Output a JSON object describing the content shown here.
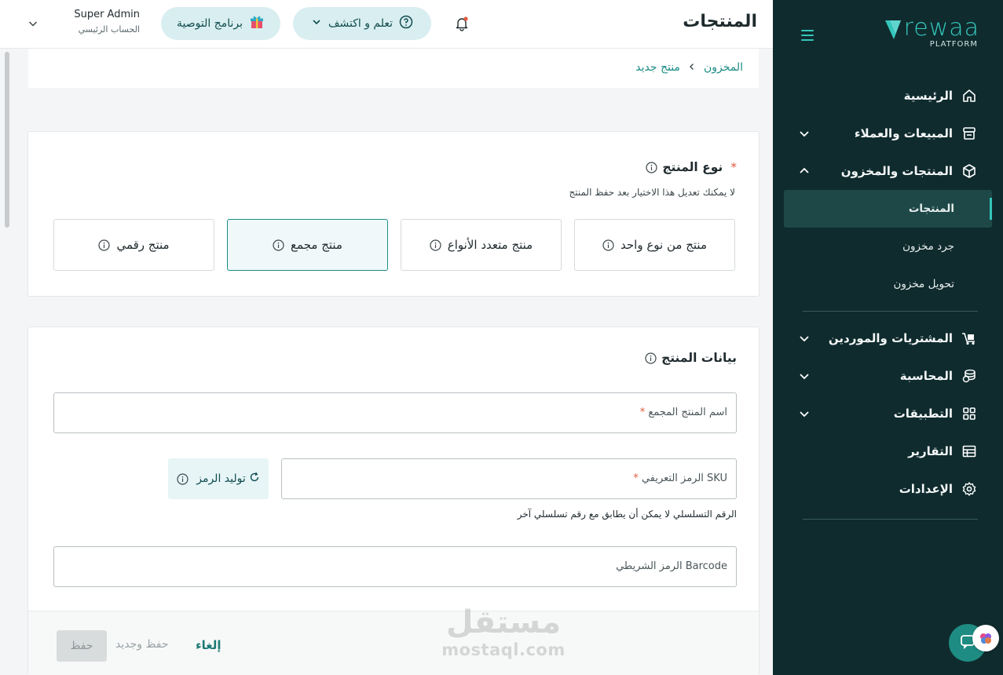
{
  "sidebar": {
    "logo_text": "rewaa",
    "logo_sub": "PLATFORM",
    "items": [
      {
        "label": "الرئيسية",
        "icon": "home-icon"
      },
      {
        "label": "المبيعات والعملاء",
        "icon": "store-icon"
      },
      {
        "label": "المنتجات والمخزون",
        "icon": "box-icon"
      },
      {
        "label": "المشتريات والموردين",
        "icon": "truck-icon"
      },
      {
        "label": "المحاسبة",
        "icon": "coins-icon"
      },
      {
        "label": "التطبيقات",
        "icon": "grid-icon"
      },
      {
        "label": "التقارير",
        "icon": "table-icon"
      },
      {
        "label": "الإعدادات",
        "icon": "gear-icon"
      }
    ],
    "sub_items": [
      "المنتجات",
      "جرد مخزون",
      "تحويل مخزون"
    ]
  },
  "header": {
    "title": "المنتجات",
    "learn_label": "تعلم و اكتشف",
    "promo_label": "برنامج التوصية",
    "user_name": "Super Admin",
    "user_role": "الحساب الرئيسي"
  },
  "breadcrumb": {
    "root": "المخزون",
    "current": "منتج جديد"
  },
  "product_type": {
    "title": "نوع المنتج",
    "required_mark": "*",
    "hint": "لا يمكنك تعديل هذا الاختيار بعد حفظ المنتج",
    "options": [
      "منتج من نوع واحد",
      "منتج متعدد الأنواع",
      "منتج مجمع",
      "منتج رقمي"
    ],
    "selected": "منتج مجمع"
  },
  "product_data": {
    "title": "بيانات المنتج",
    "name_placeholder": "اسم المنتج المجمع",
    "sku_placeholder": "الرمز التعريفي SKU",
    "generate_label": "توليد الرمز",
    "serial_hint": "الرقم التسلسلي لا يمكن أن يطابق مع رقم تسلسلي آخر",
    "barcode_placeholder": "الرمز الشريطي Barcode"
  },
  "footer": {
    "cancel_label": "إلغاء",
    "save_new_label": "حفظ وجديد",
    "save_label": "حفظ"
  },
  "watermark": {
    "arabic": "مستقل",
    "latin": "mostaql.com"
  },
  "colors": {
    "sidebar_bg": "#0f2b2e",
    "accent": "#34c6bb",
    "link": "#1c8c85",
    "required": "#e25b3f"
  }
}
